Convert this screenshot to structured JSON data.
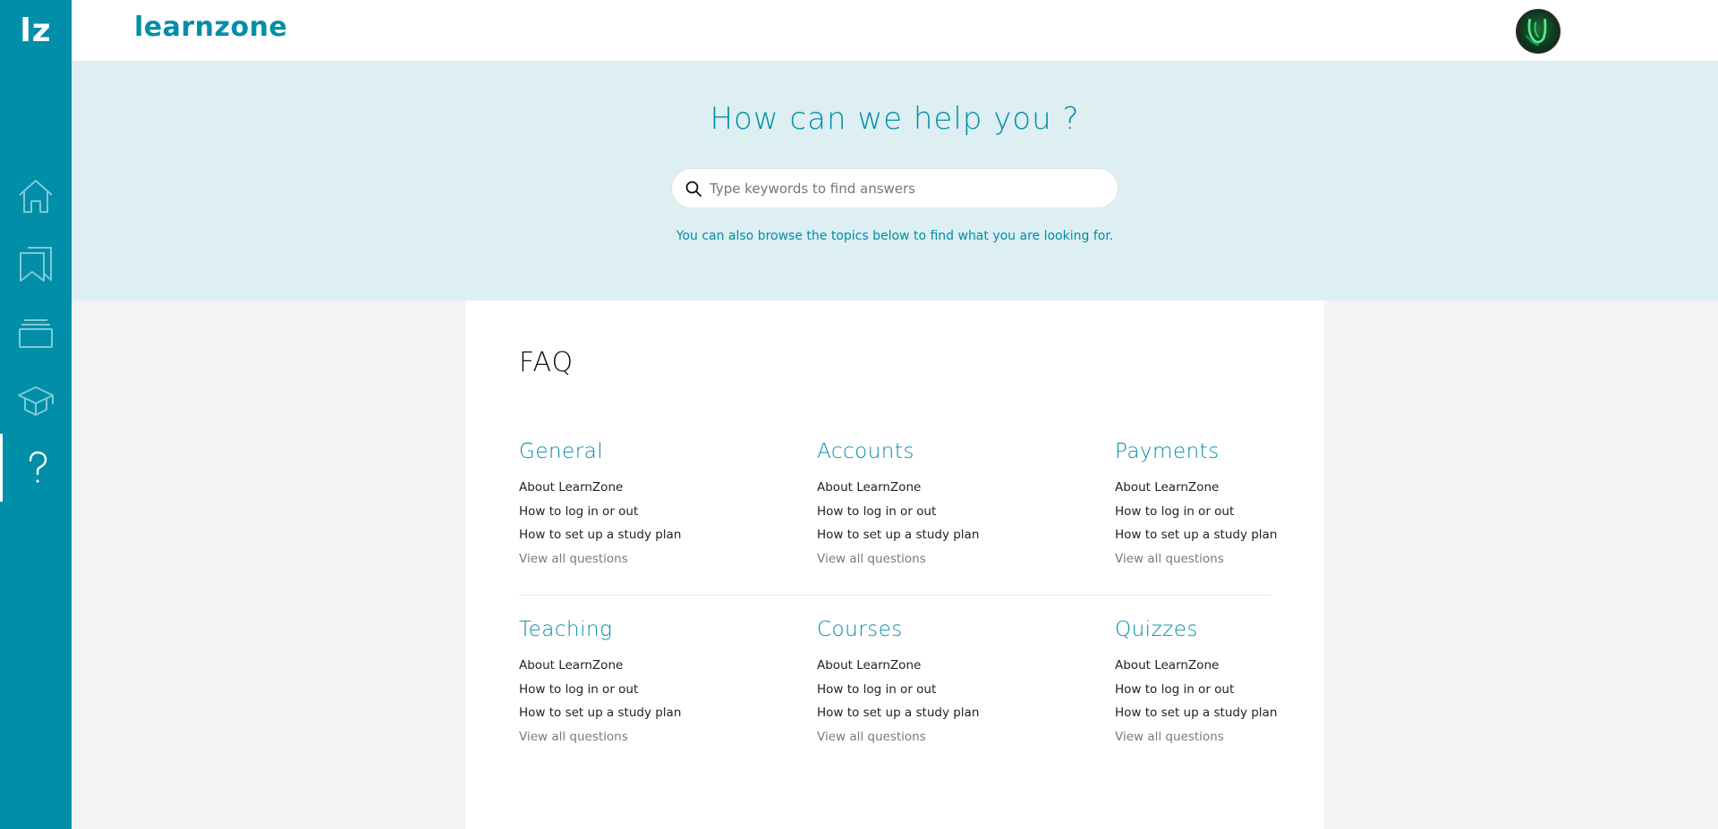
{
  "sidebar": {
    "logo": "lz",
    "items": [
      {
        "icon": "home-icon",
        "name": "sidebar-item-home"
      },
      {
        "icon": "bookmark-icon",
        "name": "sidebar-item-bookmarks"
      },
      {
        "icon": "stack-icon",
        "name": "sidebar-item-collections"
      },
      {
        "icon": "graduation-cap-icon",
        "name": "sidebar-item-courses"
      },
      {
        "icon": "question-mark-icon",
        "name": "sidebar-item-help",
        "active": true
      }
    ]
  },
  "header": {
    "brand": "learnzone",
    "avatar_icon": "user-avatar"
  },
  "hero": {
    "title": "How can we help you ?",
    "search_placeholder": "Type keywords to find answers",
    "search_value": "",
    "subtitle": "You can also browse the topics below to find what you are looking for."
  },
  "faq": {
    "title": "FAQ",
    "topics": [
      {
        "title": "General",
        "links": [
          "About LearnZone",
          "How to log in or out",
          "How to set up a study plan"
        ],
        "view_all": "View all questions"
      },
      {
        "title": "Accounts",
        "links": [
          "About LearnZone",
          "How to log in or out",
          "How to set up a study plan"
        ],
        "view_all": "View all questions"
      },
      {
        "title": "Payments",
        "links": [
          "About LearnZone",
          "How to log in or out",
          "How to set up a study plan"
        ],
        "view_all": "View all questions"
      },
      {
        "title": "Teaching",
        "links": [
          "About LearnZone",
          "How to log in or out",
          "How to set up a study plan"
        ],
        "view_all": "View all questions"
      },
      {
        "title": "Courses",
        "links": [
          "About LearnZone",
          "How to log in or out",
          "How to set up a study plan"
        ],
        "view_all": "View all questions"
      },
      {
        "title": "Quizzes",
        "links": [
          "About LearnZone",
          "How to log in or out",
          "How to set up a study plan"
        ],
        "view_all": "View all questions"
      }
    ]
  },
  "colors": {
    "brand": "#008ea8",
    "hero_bg": "#ddeff2",
    "page_bg": "#f3f3f3",
    "sidebar_icon": "#7fcad8",
    "sidebar_icon_active": "#ffffff"
  }
}
